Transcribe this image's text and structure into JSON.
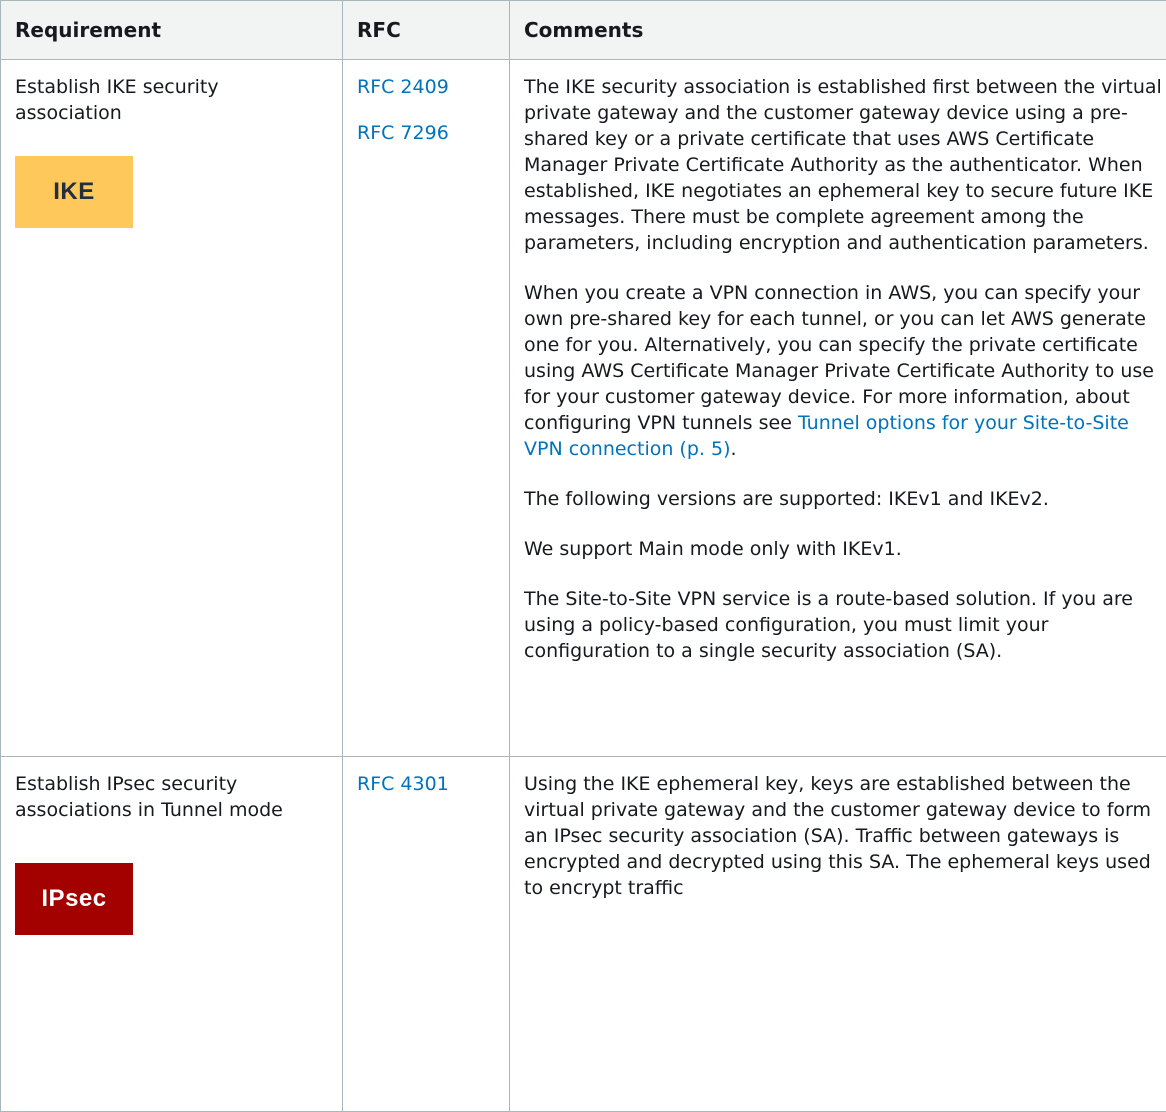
{
  "table": {
    "headers": {
      "requirement": "Requirement",
      "rfc": "RFC",
      "comments": "Comments"
    },
    "rows": [
      {
        "requirement": "Establish IKE security association",
        "badge": {
          "label": "IKE",
          "color": "#ffc85a"
        },
        "rfcs": [
          "RFC 2409",
          "RFC 7296"
        ],
        "comments": {
          "p1": "The IKE security association is established first between the virtual private gateway and the customer gateway device using a pre-shared key or a private certificate that uses AWS Certificate Manager Private Certificate Authority as the authenticator. When established, IKE negotiates an ephemeral key to secure future IKE messages. There must be complete agreement among the parameters, including encryption and authentication parameters.",
          "p2_before": "When you create a VPN connection in AWS, you can specify your own pre-shared key for each tunnel, or you can let AWS generate one for you. Alternatively, you can specify the private certificate using AWS Certificate Manager Private Certificate Authority to use for your customer gateway device. For more information, about configuring VPN tunnels see ",
          "p2_link": "Tunnel options for your Site-to-Site VPN connection (p. 5)",
          "p2_after": ".",
          "p3": "The following versions are supported: IKEv1 and IKEv2.",
          "p4": "We support Main mode only with IKEv1.",
          "p5": "The Site-to-Site VPN service is a route-based solution. If you are using a policy-based configuration, you must limit your configuration to a single security association (SA)."
        }
      },
      {
        "requirement": "Establish IPsec security associations in Tunnel mode",
        "badge": {
          "label": "IPsec",
          "color": "#a30000"
        },
        "rfcs": [
          "RFC 4301"
        ],
        "comments": {
          "p1": "Using the IKE ephemeral key, keys are established between the virtual private gateway and the customer gateway device to form an IPsec security association (SA). Traffic between gateways is encrypted and decrypted using this SA. The ephemeral keys used to encrypt traffic"
        }
      }
    ]
  }
}
